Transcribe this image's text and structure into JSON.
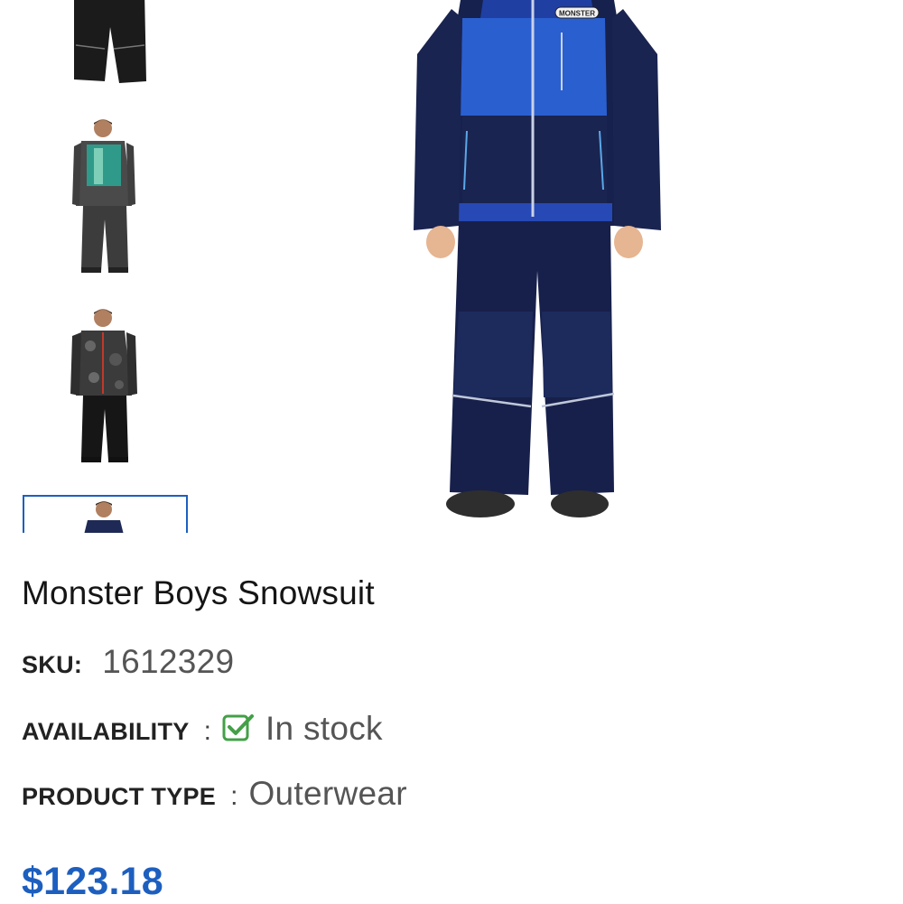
{
  "product": {
    "title": "Monster Boys Snowsuit",
    "sku_label": "SKU:",
    "sku_value": "1612329",
    "availability_label": "AVAILABILITY",
    "availability_separator": ":",
    "availability_value": "In stock",
    "product_type_label": "PRODUCT TYPE",
    "product_type_separator": ":",
    "product_type_value": "Outerwear",
    "price": "$123.18",
    "price_color": "#1d5fbf",
    "stock_color": "#43a047"
  },
  "gallery": {
    "thumbnails": [
      {
        "icon": "snowpants-black"
      },
      {
        "icon": "snowsuit-teal-grey"
      },
      {
        "icon": "snowsuit-camo-black"
      },
      {
        "icon": "snowsuit-navy-blue",
        "selected": true
      }
    ],
    "main_image": {
      "icon": "snowsuit-navy-blue",
      "brand_text": "MONSTER"
    }
  }
}
